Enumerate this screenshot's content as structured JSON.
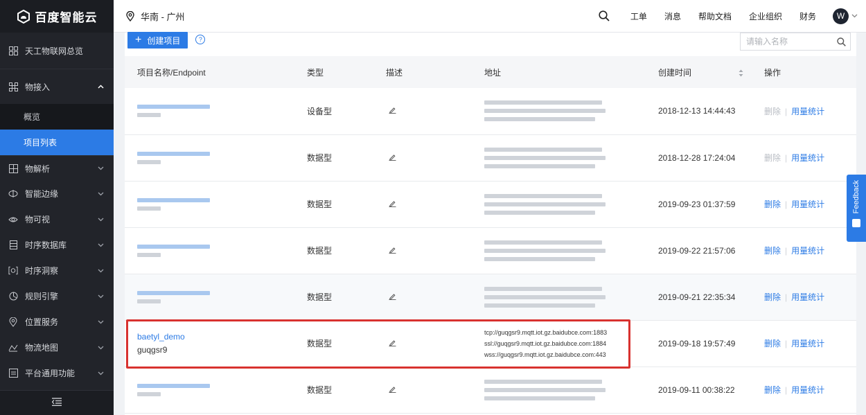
{
  "app": {
    "brand": "百度智能云"
  },
  "sidebar": {
    "overview": "天工物联网总览",
    "groups": [
      {
        "key": "access",
        "label": "物接入",
        "expanded": true,
        "icon": "device-grid-icon"
      },
      {
        "key": "parse",
        "label": "物解析",
        "expanded": false,
        "icon": "parse-grid-icon"
      },
      {
        "key": "edge",
        "label": "智能边缘",
        "expanded": false,
        "icon": "edge-icon"
      },
      {
        "key": "visual",
        "label": "物可视",
        "expanded": false,
        "icon": "eye-icon"
      },
      {
        "key": "tsdb",
        "label": "时序数据库",
        "expanded": false,
        "icon": "database-icon"
      },
      {
        "key": "insight",
        "label": "时序洞察",
        "expanded": false,
        "icon": "insight-icon"
      },
      {
        "key": "rules",
        "label": "规则引擎",
        "expanded": false,
        "icon": "rule-engine-icon"
      },
      {
        "key": "location",
        "label": "位置服务",
        "expanded": false,
        "icon": "location-pin-icon"
      },
      {
        "key": "logistics",
        "label": "物流地图",
        "expanded": false,
        "icon": "logistics-map-icon"
      },
      {
        "key": "common",
        "label": "平台通用功能",
        "expanded": false,
        "icon": "platform-icon"
      }
    ],
    "access_subs": [
      "概览",
      "项目列表"
    ],
    "active_sub": "项目列表"
  },
  "topbar": {
    "region": "华南 - 广州",
    "links": [
      "工单",
      "消息",
      "帮助文档",
      "企业组织",
      "财务"
    ],
    "avatar": "W"
  },
  "toolbar": {
    "create_label": "创建项目",
    "help": "?",
    "search_placeholder": "请输入名称"
  },
  "table": {
    "columns": [
      "项目名称/Endpoint",
      "类型",
      "描述",
      "地址",
      "创建时间",
      "操作"
    ],
    "rows": [
      {
        "name": "",
        "endpoint": "",
        "blurred": true,
        "type": "设备型",
        "created": "2018-12-13 14:44:43",
        "delete_enabled": false,
        "addr": []
      },
      {
        "name": "",
        "endpoint": "",
        "blurred": true,
        "type": "数据型",
        "created": "2018-12-28 17:24:04",
        "delete_enabled": false,
        "addr": []
      },
      {
        "name": "",
        "endpoint": "",
        "blurred": true,
        "type": "数据型",
        "created": "2019-09-23 01:37:59",
        "delete_enabled": true,
        "addr": []
      },
      {
        "name": "",
        "endpoint": "",
        "blurred": true,
        "type": "数据型",
        "created": "2019-09-22 21:57:06",
        "delete_enabled": true,
        "addr": []
      },
      {
        "name": "",
        "endpoint": "",
        "blurred": true,
        "type": "数据型",
        "created": "2019-09-21 22:35:34",
        "delete_enabled": true,
        "addr": []
      },
      {
        "name": "baetyl_demo",
        "endpoint": "guqgsr9",
        "blurred": false,
        "type": "数据型",
        "created": "2019-09-18 19:57:49",
        "delete_enabled": true,
        "addr": [
          "tcp://guqgsr9.mqtt.iot.gz.baidubce.com:1883",
          "ssl://guqgsr9.mqtt.iot.gz.baidubce.com:1884",
          "wss://guqgsr9.mqtt.iot.gz.baidubce.com:443"
        ]
      },
      {
        "name": "",
        "endpoint": "",
        "blurred": true,
        "type": "数据型",
        "created": "2019-09-11 00:38:22",
        "delete_enabled": true,
        "addr": []
      }
    ],
    "ops": {
      "delete": "删除",
      "stats": "用量统计",
      "separator": "|"
    }
  },
  "feedback": {
    "label": "Feedback"
  },
  "colors": {
    "accent": "#2c7be5",
    "sidebar_bg": "#22242a",
    "highlight": "#d8322f"
  }
}
